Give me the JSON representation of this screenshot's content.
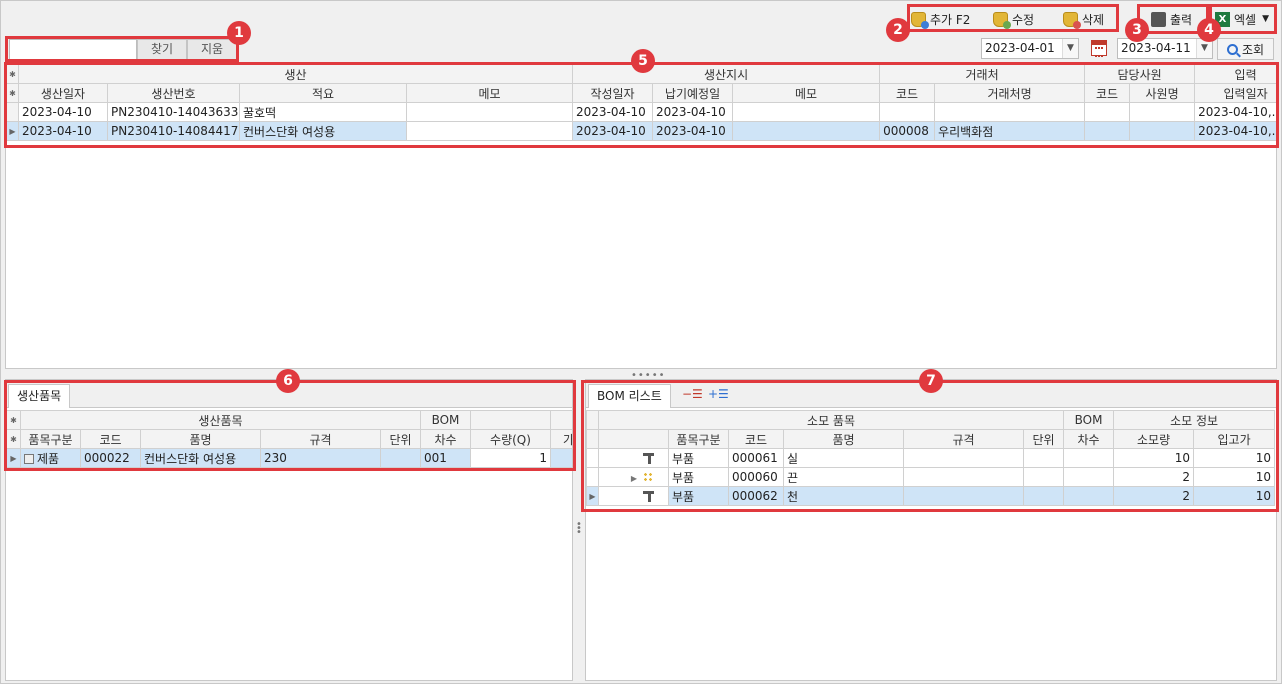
{
  "toolbar": {
    "add_label": "추가 F2",
    "edit_label": "수정",
    "delete_label": "삭제",
    "print_label": "출력",
    "excel_label": "엑셀",
    "excel_icon": "x-icon"
  },
  "search": {
    "value": "",
    "find_label": "찾기",
    "clear_label": "지움"
  },
  "date_range": {
    "from": "2023-04-01",
    "to": "2023-04-11",
    "query_label": "조회"
  },
  "callouts": [
    "1",
    "2",
    "3",
    "4",
    "5",
    "6",
    "7"
  ],
  "main_grid": {
    "group_headers": [
      "생산",
      "생산지시",
      "거래처",
      "담당사원",
      "입력"
    ],
    "columns": [
      "생산일자",
      "생산번호",
      "적요",
      "메모",
      "작성일자",
      "납기예정일",
      "메모",
      "코드",
      "거래처명",
      "코드",
      "사원명",
      "입력일자"
    ],
    "rows": [
      [
        "2023-04-10",
        "PN230410-14043633",
        "꿀호떡",
        "",
        "2023-04-10",
        "2023-04-10",
        "",
        "",
        "",
        "",
        "",
        "2023-04-10,..."
      ],
      [
        "2023-04-10",
        "PN230410-14084417",
        "컨버스단화 여성용",
        "",
        "2023-04-10",
        "2023-04-10",
        "",
        "000008",
        "우리백화점",
        "",
        "",
        "2023-04-10,..."
      ]
    ],
    "selected_row": 1
  },
  "prod_panel": {
    "tab_label": "생산품목",
    "group_headers": [
      "생산품목",
      "BOM"
    ],
    "columns": [
      "품목구분",
      "코드",
      "품명",
      "규격",
      "단위",
      "차수",
      "수량(Q)",
      "가"
    ],
    "rows": [
      [
        "제품",
        "000022",
        "컨버스단화 여성용",
        "230",
        "",
        "001",
        "1",
        ""
      ]
    ]
  },
  "bom_panel": {
    "tab_label": "BOM 리스트",
    "group_headers": [
      "소모 품목",
      "BOM",
      "소모 정보"
    ],
    "columns": [
      "품목구분",
      "코드",
      "품명",
      "규격",
      "단위",
      "차수",
      "소모량",
      "입고가"
    ],
    "rows": [
      [
        "부품",
        "000061",
        "실",
        "",
        "",
        "",
        "10",
        "10"
      ],
      [
        "부품",
        "000060",
        "끈",
        "",
        "",
        "",
        "2",
        "10"
      ],
      [
        "부품",
        "000062",
        "천",
        "",
        "",
        "",
        "2",
        "10"
      ]
    ]
  },
  "colors": {
    "accent_red": "#e0393e",
    "selected_row": "#cfe4f7"
  }
}
